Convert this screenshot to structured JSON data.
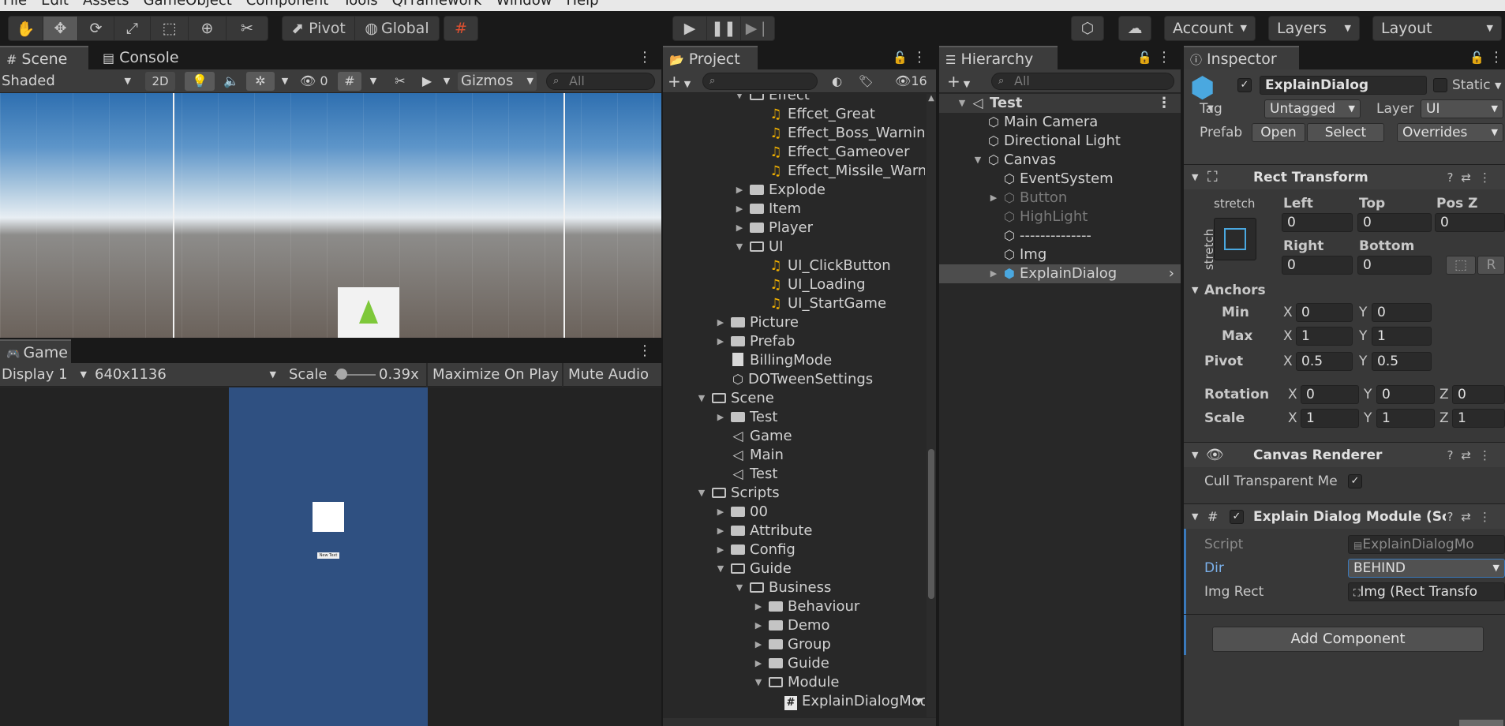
{
  "menubar": [
    "File",
    "Edit",
    "Assets",
    "GameObject",
    "Component",
    "Tools",
    "QFramework",
    "Window",
    "Help"
  ],
  "toolbar": {
    "pivot_label": "Pivot",
    "global_label": "Global",
    "account_label": "Account",
    "layers_label": "Layers",
    "layout_label": "Layout"
  },
  "scene_panel": {
    "tab_scene": "Scene",
    "tab_console": "Console",
    "shading_mode": "Shaded",
    "mode_2d": "2D",
    "hidden_count": "0",
    "gizmos_label": "Gizmos",
    "search_placeholder": "All"
  },
  "game_panel": {
    "tab_game": "Game",
    "display": "Display 1",
    "resolution": "640x1136",
    "scale_label": "Scale",
    "scale_value": "0.39x",
    "maximize_label": "Maximize On Play",
    "mute_label": "Mute Audio",
    "dialog_text": "New Text"
  },
  "project_panel": {
    "tab_label": "Project",
    "hidden_count": "16",
    "items": [
      {
        "label": "Effect",
        "indent": 3,
        "arrow": "open",
        "icon": "folder-open"
      },
      {
        "label": "Effcet_Great",
        "indent": 4,
        "arrow": "",
        "icon": "audio"
      },
      {
        "label": "Effect_Boss_Warning",
        "indent": 4,
        "arrow": "",
        "icon": "audio"
      },
      {
        "label": "Effect_Gameover",
        "indent": 4,
        "arrow": "",
        "icon": "audio"
      },
      {
        "label": "Effect_Missile_Warning",
        "indent": 4,
        "arrow": "",
        "icon": "audio"
      },
      {
        "label": "Explode",
        "indent": 3,
        "arrow": "closed",
        "icon": "folder"
      },
      {
        "label": "Item",
        "indent": 3,
        "arrow": "closed",
        "icon": "folder"
      },
      {
        "label": "Player",
        "indent": 3,
        "arrow": "closed",
        "icon": "folder"
      },
      {
        "label": "UI",
        "indent": 3,
        "arrow": "open",
        "icon": "folder-open"
      },
      {
        "label": "UI_ClickButton",
        "indent": 4,
        "arrow": "",
        "icon": "audio"
      },
      {
        "label": "UI_Loading",
        "indent": 4,
        "arrow": "",
        "icon": "audio"
      },
      {
        "label": "UI_StartGame",
        "indent": 4,
        "arrow": "",
        "icon": "audio"
      },
      {
        "label": "Picture",
        "indent": 2,
        "arrow": "closed",
        "icon": "folder"
      },
      {
        "label": "Prefab",
        "indent": 2,
        "arrow": "closed",
        "icon": "folder"
      },
      {
        "label": "BillingMode",
        "indent": 2,
        "arrow": "",
        "icon": "file"
      },
      {
        "label": "DOTweenSettings",
        "indent": 2,
        "arrow": "",
        "icon": "cube"
      },
      {
        "label": "Scene",
        "indent": 1,
        "arrow": "open",
        "icon": "folder-open"
      },
      {
        "label": "Test",
        "indent": 2,
        "arrow": "closed",
        "icon": "folder"
      },
      {
        "label": "Game",
        "indent": 2,
        "arrow": "",
        "icon": "unity"
      },
      {
        "label": "Main",
        "indent": 2,
        "arrow": "",
        "icon": "unity"
      },
      {
        "label": "Test",
        "indent": 2,
        "arrow": "",
        "icon": "unity"
      },
      {
        "label": "Scripts",
        "indent": 1,
        "arrow": "open",
        "icon": "folder-open"
      },
      {
        "label": "00",
        "indent": 2,
        "arrow": "closed",
        "icon": "folder"
      },
      {
        "label": "Attribute",
        "indent": 2,
        "arrow": "closed",
        "icon": "folder"
      },
      {
        "label": "Config",
        "indent": 2,
        "arrow": "closed",
        "icon": "folder"
      },
      {
        "label": "Guide",
        "indent": 2,
        "arrow": "open",
        "icon": "folder-open"
      },
      {
        "label": "Business",
        "indent": 3,
        "arrow": "open",
        "icon": "folder-open"
      },
      {
        "label": "Behaviour",
        "indent": 4,
        "arrow": "closed",
        "icon": "folder"
      },
      {
        "label": "Demo",
        "indent": 4,
        "arrow": "closed",
        "icon": "folder"
      },
      {
        "label": "Group",
        "indent": 4,
        "arrow": "closed",
        "icon": "folder"
      },
      {
        "label": "Guide",
        "indent": 4,
        "arrow": "closed",
        "icon": "folder"
      },
      {
        "label": "Module",
        "indent": 4,
        "arrow": "open",
        "icon": "folder-open"
      },
      {
        "label": "ExplainDialogModule",
        "indent": 5,
        "arrow": "",
        "icon": "cs"
      }
    ]
  },
  "hierarchy_panel": {
    "tab_label": "Hierarchy",
    "search_placeholder": "All",
    "items": [
      {
        "label": "Test",
        "indent": 0,
        "arrow": "open",
        "icon": "unity",
        "style": "scene"
      },
      {
        "label": "Main Camera",
        "indent": 1,
        "arrow": "",
        "icon": "cube",
        "style": "normal"
      },
      {
        "label": "Directional Light",
        "indent": 1,
        "arrow": "",
        "icon": "cube",
        "style": "normal"
      },
      {
        "label": "Canvas",
        "indent": 1,
        "arrow": "open",
        "icon": "cube",
        "style": "normal"
      },
      {
        "label": "EventSystem",
        "indent": 2,
        "arrow": "",
        "icon": "cube",
        "style": "normal"
      },
      {
        "label": "Button",
        "indent": 2,
        "arrow": "closed",
        "icon": "cube",
        "style": "disabled"
      },
      {
        "label": "HighLight",
        "indent": 2,
        "arrow": "",
        "icon": "cube",
        "style": "disabled"
      },
      {
        "label": "--------------",
        "indent": 2,
        "arrow": "",
        "icon": "cube",
        "style": "normal"
      },
      {
        "label": "Img",
        "indent": 2,
        "arrow": "",
        "icon": "cube",
        "style": "normal"
      },
      {
        "label": "ExplainDialog",
        "indent": 2,
        "arrow": "closed",
        "icon": "cube-blue",
        "style": "selected"
      }
    ]
  },
  "inspector": {
    "tab_label": "Inspector",
    "object_name": "ExplainDialog",
    "static_label": "Static",
    "tag_label": "Tag",
    "tag_value": "Untagged",
    "layer_label": "Layer",
    "layer_value": "UI",
    "prefab_label": "Prefab",
    "open_label": "Open",
    "select_label": "Select",
    "overrides_label": "Overrides",
    "rect_transform": {
      "title": "Rect Transform",
      "anchor_h": "stretch",
      "anchor_v": "stretch",
      "left_label": "Left",
      "left_value": "0",
      "top_label": "Top",
      "top_value": "0",
      "posz_label": "Pos Z",
      "posz_value": "0",
      "right_label": "Right",
      "right_value": "0",
      "bottom_label": "Bottom",
      "bottom_value": "0",
      "r_button": "R",
      "anchors_label": "Anchors",
      "min_label": "Min",
      "min_x": "0",
      "min_y": "0",
      "max_label": "Max",
      "max_x": "1",
      "max_y": "1",
      "pivot_label": "Pivot",
      "pivot_x": "0.5",
      "pivot_y": "0.5",
      "rotation_label": "Rotation",
      "rot_x": "0",
      "rot_y": "0",
      "rot_z": "0",
      "scale_label": "Scale",
      "scale_x": "1",
      "scale_y": "1",
      "scale_z": "1",
      "x": "X",
      "y": "Y",
      "z": "Z"
    },
    "canvas_renderer": {
      "title": "Canvas Renderer",
      "cull_label": "Cull Transparent Me"
    },
    "explain_module": {
      "title": "Explain Dialog Module (Sc",
      "script_label": "Script",
      "script_value": "ExplainDialogMo",
      "dir_label": "Dir",
      "dir_value": "BEHIND",
      "imgrect_label": "Img Rect",
      "imgrect_value": "Img (Rect Transfo"
    },
    "add_component_label": "Add Component"
  },
  "colors": {
    "game_view_bg": "#2f5081",
    "accent": "#3a79bb",
    "audio_icon": "#f0b000"
  }
}
